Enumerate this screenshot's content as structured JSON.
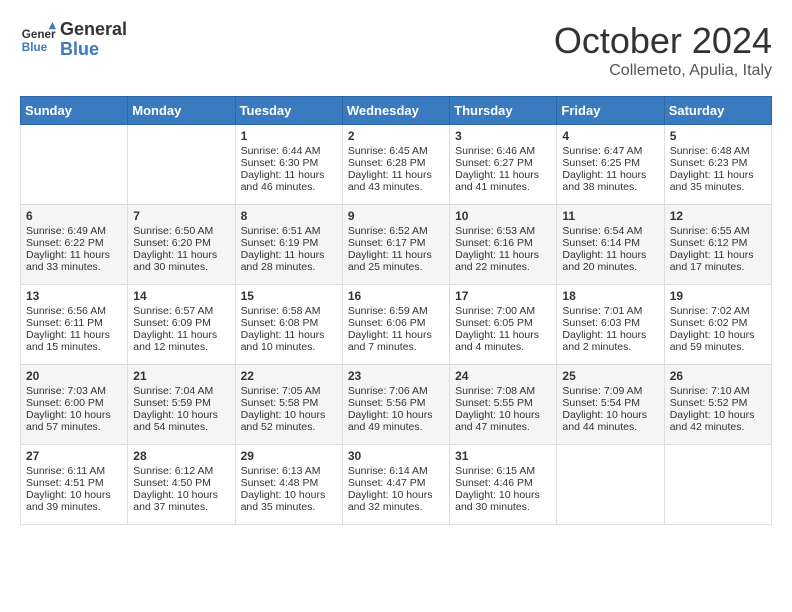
{
  "header": {
    "logo_general": "General",
    "logo_blue": "Blue",
    "month": "October 2024",
    "location": "Collemeto, Apulia, Italy"
  },
  "days_of_week": [
    "Sunday",
    "Monday",
    "Tuesday",
    "Wednesday",
    "Thursday",
    "Friday",
    "Saturday"
  ],
  "weeks": [
    [
      {
        "day": "",
        "sunrise": "",
        "sunset": "",
        "daylight": ""
      },
      {
        "day": "",
        "sunrise": "",
        "sunset": "",
        "daylight": ""
      },
      {
        "day": "1",
        "sunrise": "Sunrise: 6:44 AM",
        "sunset": "Sunset: 6:30 PM",
        "daylight": "Daylight: 11 hours and 46 minutes."
      },
      {
        "day": "2",
        "sunrise": "Sunrise: 6:45 AM",
        "sunset": "Sunset: 6:28 PM",
        "daylight": "Daylight: 11 hours and 43 minutes."
      },
      {
        "day": "3",
        "sunrise": "Sunrise: 6:46 AM",
        "sunset": "Sunset: 6:27 PM",
        "daylight": "Daylight: 11 hours and 41 minutes."
      },
      {
        "day": "4",
        "sunrise": "Sunrise: 6:47 AM",
        "sunset": "Sunset: 6:25 PM",
        "daylight": "Daylight: 11 hours and 38 minutes."
      },
      {
        "day": "5",
        "sunrise": "Sunrise: 6:48 AM",
        "sunset": "Sunset: 6:23 PM",
        "daylight": "Daylight: 11 hours and 35 minutes."
      }
    ],
    [
      {
        "day": "6",
        "sunrise": "Sunrise: 6:49 AM",
        "sunset": "Sunset: 6:22 PM",
        "daylight": "Daylight: 11 hours and 33 minutes."
      },
      {
        "day": "7",
        "sunrise": "Sunrise: 6:50 AM",
        "sunset": "Sunset: 6:20 PM",
        "daylight": "Daylight: 11 hours and 30 minutes."
      },
      {
        "day": "8",
        "sunrise": "Sunrise: 6:51 AM",
        "sunset": "Sunset: 6:19 PM",
        "daylight": "Daylight: 11 hours and 28 minutes."
      },
      {
        "day": "9",
        "sunrise": "Sunrise: 6:52 AM",
        "sunset": "Sunset: 6:17 PM",
        "daylight": "Daylight: 11 hours and 25 minutes."
      },
      {
        "day": "10",
        "sunrise": "Sunrise: 6:53 AM",
        "sunset": "Sunset: 6:16 PM",
        "daylight": "Daylight: 11 hours and 22 minutes."
      },
      {
        "day": "11",
        "sunrise": "Sunrise: 6:54 AM",
        "sunset": "Sunset: 6:14 PM",
        "daylight": "Daylight: 11 hours and 20 minutes."
      },
      {
        "day": "12",
        "sunrise": "Sunrise: 6:55 AM",
        "sunset": "Sunset: 6:12 PM",
        "daylight": "Daylight: 11 hours and 17 minutes."
      }
    ],
    [
      {
        "day": "13",
        "sunrise": "Sunrise: 6:56 AM",
        "sunset": "Sunset: 6:11 PM",
        "daylight": "Daylight: 11 hours and 15 minutes."
      },
      {
        "day": "14",
        "sunrise": "Sunrise: 6:57 AM",
        "sunset": "Sunset: 6:09 PM",
        "daylight": "Daylight: 11 hours and 12 minutes."
      },
      {
        "day": "15",
        "sunrise": "Sunrise: 6:58 AM",
        "sunset": "Sunset: 6:08 PM",
        "daylight": "Daylight: 11 hours and 10 minutes."
      },
      {
        "day": "16",
        "sunrise": "Sunrise: 6:59 AM",
        "sunset": "Sunset: 6:06 PM",
        "daylight": "Daylight: 11 hours and 7 minutes."
      },
      {
        "day": "17",
        "sunrise": "Sunrise: 7:00 AM",
        "sunset": "Sunset: 6:05 PM",
        "daylight": "Daylight: 11 hours and 4 minutes."
      },
      {
        "day": "18",
        "sunrise": "Sunrise: 7:01 AM",
        "sunset": "Sunset: 6:03 PM",
        "daylight": "Daylight: 11 hours and 2 minutes."
      },
      {
        "day": "19",
        "sunrise": "Sunrise: 7:02 AM",
        "sunset": "Sunset: 6:02 PM",
        "daylight": "Daylight: 10 hours and 59 minutes."
      }
    ],
    [
      {
        "day": "20",
        "sunrise": "Sunrise: 7:03 AM",
        "sunset": "Sunset: 6:00 PM",
        "daylight": "Daylight: 10 hours and 57 minutes."
      },
      {
        "day": "21",
        "sunrise": "Sunrise: 7:04 AM",
        "sunset": "Sunset: 5:59 PM",
        "daylight": "Daylight: 10 hours and 54 minutes."
      },
      {
        "day": "22",
        "sunrise": "Sunrise: 7:05 AM",
        "sunset": "Sunset: 5:58 PM",
        "daylight": "Daylight: 10 hours and 52 minutes."
      },
      {
        "day": "23",
        "sunrise": "Sunrise: 7:06 AM",
        "sunset": "Sunset: 5:56 PM",
        "daylight": "Daylight: 10 hours and 49 minutes."
      },
      {
        "day": "24",
        "sunrise": "Sunrise: 7:08 AM",
        "sunset": "Sunset: 5:55 PM",
        "daylight": "Daylight: 10 hours and 47 minutes."
      },
      {
        "day": "25",
        "sunrise": "Sunrise: 7:09 AM",
        "sunset": "Sunset: 5:54 PM",
        "daylight": "Daylight: 10 hours and 44 minutes."
      },
      {
        "day": "26",
        "sunrise": "Sunrise: 7:10 AM",
        "sunset": "Sunset: 5:52 PM",
        "daylight": "Daylight: 10 hours and 42 minutes."
      }
    ],
    [
      {
        "day": "27",
        "sunrise": "Sunrise: 6:11 AM",
        "sunset": "Sunset: 4:51 PM",
        "daylight": "Daylight: 10 hours and 39 minutes."
      },
      {
        "day": "28",
        "sunrise": "Sunrise: 6:12 AM",
        "sunset": "Sunset: 4:50 PM",
        "daylight": "Daylight: 10 hours and 37 minutes."
      },
      {
        "day": "29",
        "sunrise": "Sunrise: 6:13 AM",
        "sunset": "Sunset: 4:48 PM",
        "daylight": "Daylight: 10 hours and 35 minutes."
      },
      {
        "day": "30",
        "sunrise": "Sunrise: 6:14 AM",
        "sunset": "Sunset: 4:47 PM",
        "daylight": "Daylight: 10 hours and 32 minutes."
      },
      {
        "day": "31",
        "sunrise": "Sunrise: 6:15 AM",
        "sunset": "Sunset: 4:46 PM",
        "daylight": "Daylight: 10 hours and 30 minutes."
      },
      {
        "day": "",
        "sunrise": "",
        "sunset": "",
        "daylight": ""
      },
      {
        "day": "",
        "sunrise": "",
        "sunset": "",
        "daylight": ""
      }
    ]
  ]
}
